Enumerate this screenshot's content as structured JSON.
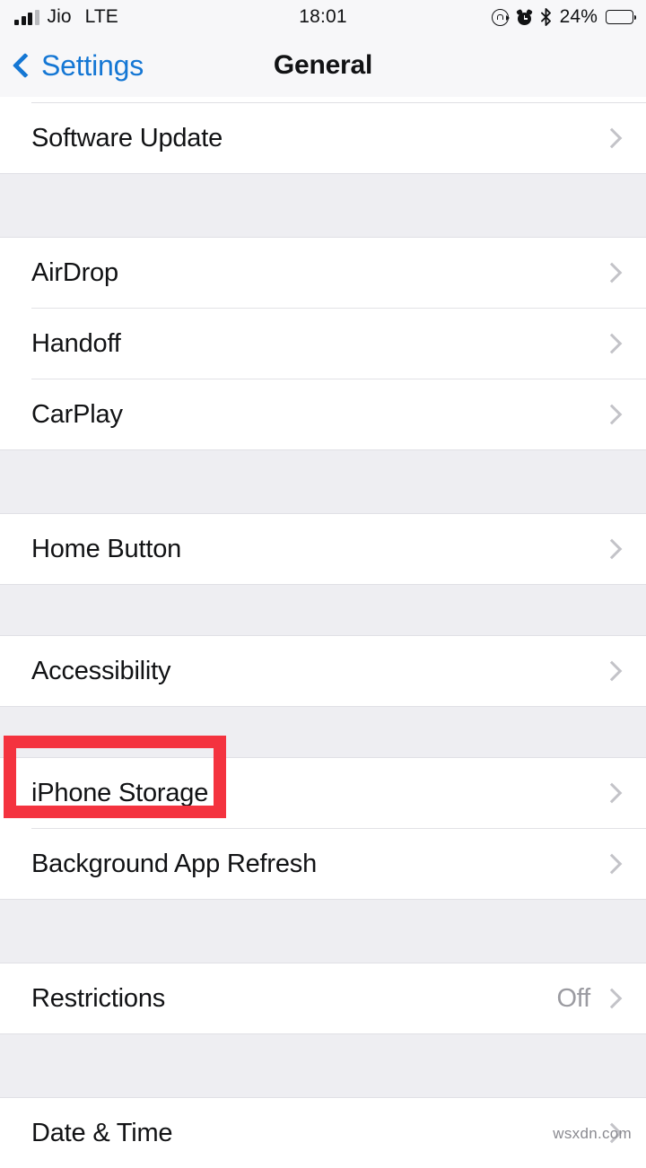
{
  "status_bar": {
    "carrier": "Jio",
    "network": "LTE",
    "time": "18:01",
    "battery_percent": "24%",
    "battery_level": 24,
    "icons": [
      "signal-bars-icon",
      "rotation-lock-icon",
      "alarm-clock-icon",
      "bluetooth-icon",
      "battery-icon"
    ]
  },
  "nav_bar": {
    "back_label": "Settings",
    "title": "General"
  },
  "colors": {
    "accent_blue": "#1577d4",
    "highlight_red": "#f4333f",
    "group_background": "#eeeef2",
    "row_background": "#ffffff",
    "value_gray": "#9b9ba1"
  },
  "groups": [
    {
      "rows": [
        {
          "label": "Software Update",
          "value": "",
          "highlighted": false
        }
      ]
    },
    {
      "rows": [
        {
          "label": "AirDrop",
          "value": "",
          "highlighted": false
        },
        {
          "label": "Handoff",
          "value": "",
          "highlighted": false
        },
        {
          "label": "CarPlay",
          "value": "",
          "highlighted": false
        }
      ]
    },
    {
      "rows": [
        {
          "label": "Home Button",
          "value": "",
          "highlighted": false
        }
      ]
    },
    {
      "rows": [
        {
          "label": "Accessibility",
          "value": "",
          "highlighted": true
        }
      ]
    },
    {
      "rows": [
        {
          "label": "iPhone Storage",
          "value": "",
          "highlighted": false
        },
        {
          "label": "Background App Refresh",
          "value": "",
          "highlighted": false
        }
      ]
    },
    {
      "rows": [
        {
          "label": "Restrictions",
          "value": "Off",
          "highlighted": false
        }
      ]
    },
    {
      "rows": [
        {
          "label": "Date & Time",
          "value": "",
          "highlighted": false
        }
      ]
    }
  ],
  "watermark": "wsxdn.com"
}
